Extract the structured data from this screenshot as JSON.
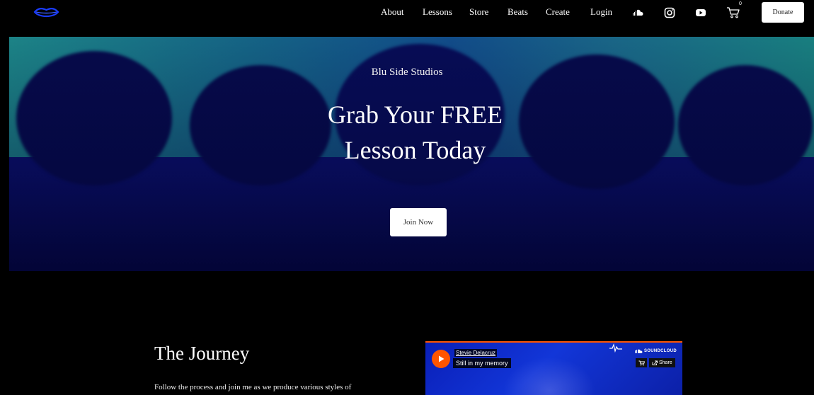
{
  "header": {
    "nav": [
      {
        "label": "About"
      },
      {
        "label": "Lessons"
      },
      {
        "label": "Store"
      },
      {
        "label": "Beats"
      },
      {
        "label": "Create"
      },
      {
        "label": "Login"
      }
    ],
    "social_icons": [
      "soundcloud-icon",
      "instagram-icon",
      "youtube-icon"
    ],
    "cart_count": "0",
    "donate_label": "Donate"
  },
  "hero": {
    "subtitle": "Blu Side Studios",
    "title_line1": "Grab Your FREE",
    "title_line2": "Lesson Today",
    "cta_label": "Join Now"
  },
  "journey": {
    "title": "The Journey",
    "text": "Follow the process and join me as we produce various styles of"
  },
  "embed": {
    "artist": "Stevie Delacruz",
    "track": "Still in my memory",
    "brand": "SOUNDCLOUD",
    "share_label": "Share"
  },
  "colors": {
    "accent_logo": "#1a3cff",
    "soundcloud_orange": "#ff5500"
  }
}
